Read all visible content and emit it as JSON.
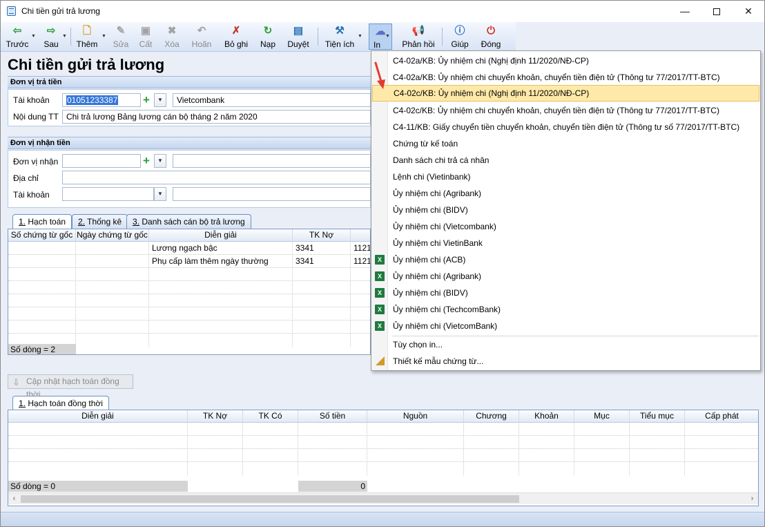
{
  "window": {
    "title": "Chi tiền gửi trả lương"
  },
  "toolbar": {
    "prev": "Trước",
    "next": "Sau",
    "add": "Thêm",
    "edit": "Sửa",
    "save": "Cất",
    "delete": "Xóa",
    "undo": "Hoãn",
    "unpost": "Bỏ ghi",
    "load": "Nạp",
    "approve": "Duyệt",
    "utilities": "Tiện ích",
    "print": "In",
    "feedback": "Phản hồi",
    "help": "Giúp",
    "close": "Đóng"
  },
  "page": {
    "title": "Chi tiền gửi trả lương"
  },
  "payer": {
    "header": "Đơn vị trả tiền",
    "account_label": "Tài khoản",
    "account_value": "01051233387",
    "bank_name": "Vietcombank",
    "content_label": "Nội dung TT",
    "content_value": "Chi trả lương Bảng lương cán bộ tháng 2 năm 2020"
  },
  "payee": {
    "header": "Đơn vị nhận tiền",
    "unit_label": "Đơn vị nhận",
    "address_label": "Địa chỉ",
    "account_label": "Tài khoản"
  },
  "tabs": [
    {
      "num": "1.",
      "label": " Hạch toán"
    },
    {
      "num": "2.",
      "label": " Thống kê"
    },
    {
      "num": "3.",
      "label": " Danh sách cán bộ trả lương"
    }
  ],
  "grid1": {
    "columns": [
      "Số chứng từ gốc",
      "Ngày chứng từ gốc",
      "Diễn giải",
      "TK Nợ",
      "T"
    ],
    "rows": [
      {
        "desc": "Lương ngạch bậc",
        "debit": "3341",
        "credit": "1121"
      },
      {
        "desc": "Phụ cấp làm thêm ngày thường",
        "debit": "3341",
        "credit": "1121"
      }
    ],
    "footer": "Số dòng = 2"
  },
  "update_button": "Cập nhật hạch toán đồng thời",
  "tab2": {
    "num": "1.",
    "label": " Hạch toán đồng thời"
  },
  "grid2": {
    "columns": [
      "Diễn giải",
      "TK Nợ",
      "TK Có",
      "Số tiền",
      "Nguồn",
      "Chương",
      "Khoản",
      "Mục",
      "Tiểu mục",
      "Cấp phát"
    ],
    "footer": "Số dòng = 0",
    "total": "0"
  },
  "print_menu": {
    "items": [
      "C4-02a/KB: Ủy nhiệm chi (Nghị định 11/2020/NĐ-CP)",
      "C4-02a/KB: Ủy nhiệm chi chuyển khoản, chuyển tiền điện tử (Thông tư 77/2017/TT-BTC)",
      "C4-02c/KB: Ủy nhiệm chi (Nghị định 11/2020/NĐ-CP)",
      "C4-02c/KB: Ủy nhiệm chi chuyển khoản, chuyển tiền điện tử (Thông tư 77/2017/TT-BTC)",
      "C4-11/KB: Giấy chuyển tiền chuyển khoản, chuyển tiền điện tử (Thông tư số 77/2017/TT-BTC)",
      "Chứng từ kế toán",
      "Danh sách chi trả cá nhân",
      "Lệnh chi (Vietinbank)",
      "Ủy nhiệm chi (Agribank)",
      "Ủy nhiệm chi (BIDV)",
      "Ủy nhiệm chi (Vietcombank)",
      "Ủy nhiệm chi VietinBank",
      "Ủy nhiệm chi (ACB)",
      "Ủy nhiệm chi (Agribank)",
      "Ủy nhiệm chi (BIDV)",
      "Ủy nhiệm chi (TechcomBank)",
      "Ủy nhiệm chi (VietcomBank)"
    ],
    "options": "Tùy chọn in...",
    "design": "Thiết kế mẫu chứng từ..."
  }
}
